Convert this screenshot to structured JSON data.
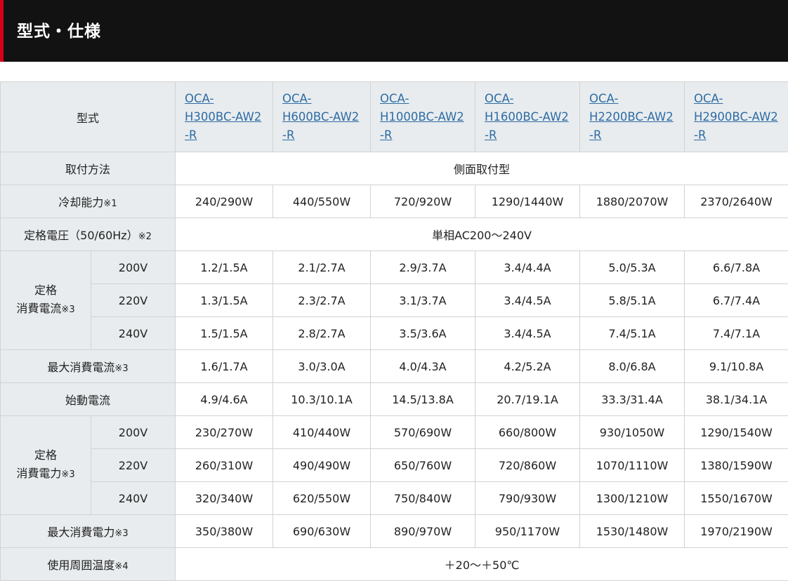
{
  "header": {
    "title": "型式・仕様"
  },
  "table": {
    "model_label": "型式",
    "models": [
      [
        "OCA-",
        "H300BC-AW2",
        "-R"
      ],
      [
        "OCA-",
        "H600BC-AW2",
        "-R"
      ],
      [
        "OCA-",
        "H1000BC-AW2",
        "-R"
      ],
      [
        "OCA-",
        "H1600BC-AW2",
        "-R"
      ],
      [
        "OCA-",
        "H2200BC-AW2",
        "-R"
      ],
      [
        "OCA-",
        "H2900BC-AW2",
        "-R"
      ]
    ],
    "mounting": {
      "label": "取付方法",
      "value": "側面取付型"
    },
    "cooling": {
      "label": "冷却能力",
      "note": "※1",
      "values": [
        "240/290W",
        "440/550W",
        "720/920W",
        "1290/1440W",
        "1880/2070W",
        "2370/2640W"
      ]
    },
    "voltage": {
      "label": "定格電圧（50/60Hz）",
      "note": "※2",
      "value": "単相AC200～240V"
    },
    "rated_current": {
      "label_line1": "定格",
      "label_line2": "消費電流",
      "note": "※3",
      "rows": [
        {
          "v": "200V",
          "values": [
            "1.2/1.5A",
            "2.1/2.7A",
            "2.9/3.7A",
            "3.4/4.4A",
            "5.0/5.3A",
            "6.6/7.8A"
          ]
        },
        {
          "v": "220V",
          "values": [
            "1.3/1.5A",
            "2.3/2.7A",
            "3.1/3.7A",
            "3.4/4.5A",
            "5.8/5.1A",
            "6.7/7.4A"
          ]
        },
        {
          "v": "240V",
          "values": [
            "1.5/1.5A",
            "2.8/2.7A",
            "3.5/3.6A",
            "3.4/4.5A",
            "7.4/5.1A",
            "7.4/7.1A"
          ]
        }
      ]
    },
    "max_current": {
      "label": "最大消費電流",
      "note": "※3",
      "values": [
        "1.6/1.7A",
        "3.0/3.0A",
        "4.0/4.3A",
        "4.2/5.2A",
        "8.0/6.8A",
        "9.1/10.8A"
      ]
    },
    "start_current": {
      "label": "始動電流",
      "values": [
        "4.9/4.6A",
        "10.3/10.1A",
        "14.5/13.8A",
        "20.7/19.1A",
        "33.3/31.4A",
        "38.1/34.1A"
      ]
    },
    "rated_power": {
      "label_line1": "定格",
      "label_line2": "消費電力",
      "note": "※3",
      "rows": [
        {
          "v": "200V",
          "values": [
            "230/270W",
            "410/440W",
            "570/690W",
            "660/800W",
            "930/1050W",
            "1290/1540W"
          ]
        },
        {
          "v": "220V",
          "values": [
            "260/310W",
            "490/490W",
            "650/760W",
            "720/860W",
            "1070/1110W",
            "1380/1590W"
          ]
        },
        {
          "v": "240V",
          "values": [
            "320/340W",
            "620/550W",
            "750/840W",
            "790/930W",
            "1300/1210W",
            "1550/1670W"
          ]
        }
      ]
    },
    "max_power": {
      "label": "最大消費電力",
      "note": "※3",
      "values": [
        "350/380W",
        "690/630W",
        "890/970W",
        "950/1170W",
        "1530/1480W",
        "1970/2190W"
      ]
    },
    "ambient": {
      "label": "使用周囲温度",
      "note": "※4",
      "value": "＋20～＋50℃"
    }
  }
}
